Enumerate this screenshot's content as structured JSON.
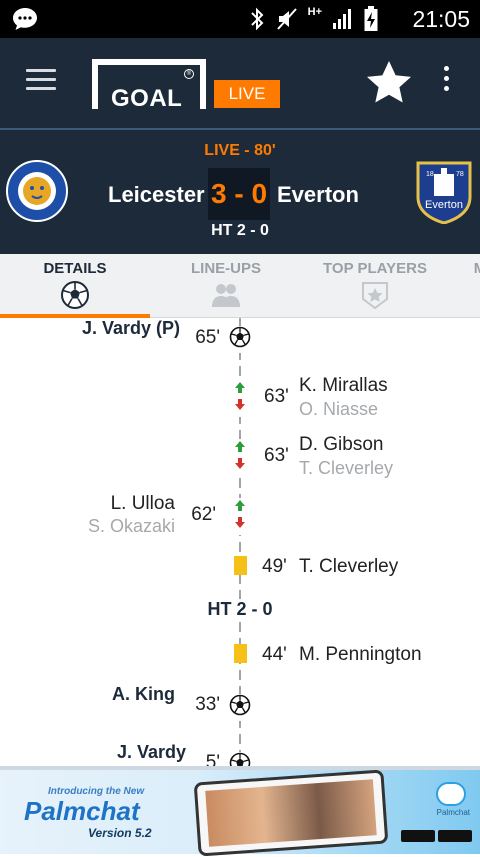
{
  "status_bar": {
    "time": "21:05",
    "network": "H+",
    "icons": [
      "chat-bubble-icon",
      "bluetooth-icon",
      "mute-icon",
      "signal-icon",
      "battery-charging-icon"
    ]
  },
  "header": {
    "logo_text": "GOAL",
    "live_badge": "LIVE",
    "menu_icon": "hamburger-icon",
    "favorite_icon": "star-icon",
    "more_icon": "more-vert-icon"
  },
  "match": {
    "status": "LIVE - 80'",
    "home_team": "Leicester",
    "away_team": "Everton",
    "score": "3 - 0",
    "halftime": "HT 2 - 0",
    "away_crest_text": "Everton",
    "away_crest_years": [
      "18",
      "78"
    ]
  },
  "tabs": [
    {
      "label": "DETAILS",
      "icon": "football-icon",
      "active": true
    },
    {
      "label": "LINE-UPS",
      "icon": "players-icon",
      "active": false
    },
    {
      "label": "TOP PLAYERS",
      "icon": "star-badge-icon",
      "active": false
    },
    {
      "label": "M",
      "icon": "",
      "active": false
    }
  ],
  "timeline": {
    "ht_label": "HT 2 - 0",
    "events": [
      {
        "minute": "65'",
        "type": "goal",
        "side": "home",
        "player": "J. Vardy (P)"
      },
      {
        "minute": "63'",
        "type": "substitution",
        "side": "away",
        "player_in": "K. Mirallas",
        "player_out": "O. Niasse"
      },
      {
        "minute": "63'",
        "type": "substitution",
        "side": "away",
        "player_in": "D. Gibson",
        "player_out": "T. Cleverley"
      },
      {
        "minute": "62'",
        "type": "substitution",
        "side": "home",
        "player_in": "L. Ulloa",
        "player_out": "S. Okazaki"
      },
      {
        "minute": "49'",
        "type": "yellow-card",
        "side": "away",
        "player": "T. Cleverley"
      },
      {
        "minute": "44'",
        "type": "yellow-card",
        "side": "away",
        "player": "M. Pennington"
      },
      {
        "minute": "33'",
        "type": "goal",
        "side": "home",
        "player": "A. King"
      },
      {
        "minute": "5'",
        "type": "goal",
        "side": "home",
        "player": "J. Vardy"
      }
    ]
  },
  "ad": {
    "intro": "Introducing the New",
    "name": "Palmchat",
    "version": "Version 5.2",
    "logo_label": "Palmchat"
  },
  "colors": {
    "navy": "#1d2a39",
    "accent_orange": "#ff7a00",
    "card_yellow": "#f5c117",
    "sub_in_green": "#2e9e3a",
    "sub_out_red": "#d2332b"
  }
}
